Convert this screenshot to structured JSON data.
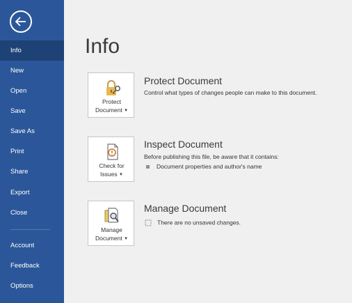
{
  "sidebar": {
    "back_icon": "back-arrow-icon",
    "items": [
      {
        "label": "Info",
        "active": true
      },
      {
        "label": "New"
      },
      {
        "label": "Open"
      },
      {
        "label": "Save"
      },
      {
        "label": "Save As"
      },
      {
        "label": "Print"
      },
      {
        "label": "Share"
      },
      {
        "label": "Export"
      },
      {
        "label": "Close"
      },
      {
        "label": "Account"
      },
      {
        "label": "Feedback"
      },
      {
        "label": "Options"
      }
    ]
  },
  "main": {
    "title": "Info",
    "sections": [
      {
        "button_line1": "Protect",
        "button_line2": "Document",
        "icon": "lock-key-icon",
        "heading": "Protect Document",
        "description": "Control what types of changes people can make to this document."
      },
      {
        "button_line1": "Check for",
        "button_line2": "Issues",
        "icon": "document-check-icon",
        "heading": "Inspect Document",
        "description": "Before publishing this file, be aware that it contains:",
        "bullet": "Document properties and author's name"
      },
      {
        "button_line1": "Manage",
        "button_line2": "Document",
        "icon": "document-search-icon",
        "heading": "Manage Document",
        "status_icon": "document-dotted-icon",
        "status": "There are no unsaved changes."
      }
    ]
  },
  "colors": {
    "sidebar": "#2b579a",
    "sidebar_active": "#1e4275",
    "background": "#f0f0f0"
  }
}
